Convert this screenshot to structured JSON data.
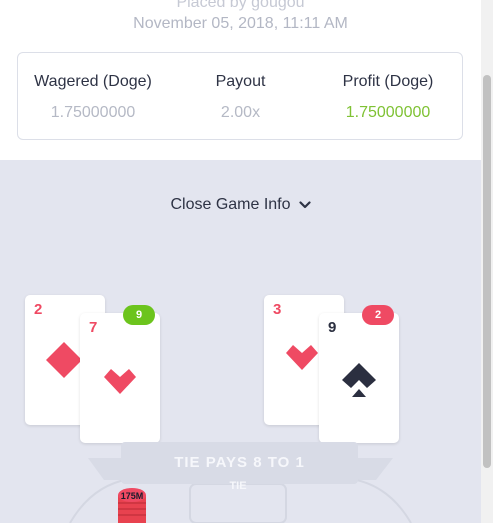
{
  "header": {
    "placed_by": "Placed by gougou",
    "date": "November 05, 2018, 11:11 AM"
  },
  "stats": {
    "wagered": {
      "label": "Wagered (Doge)",
      "value": "1.75000000"
    },
    "payout": {
      "label": "Payout",
      "value": "2.00x"
    },
    "profit": {
      "label": "Profit (Doge)",
      "value": "1.75000000"
    }
  },
  "toggle": {
    "label": "Close Game Info"
  },
  "player_hand": {
    "total": "9",
    "cards": [
      {
        "rank": "2",
        "suit": "diamond-icon"
      },
      {
        "rank": "7",
        "suit": "heart-icon"
      }
    ]
  },
  "banker_hand": {
    "total": "2",
    "cards": [
      {
        "rank": "3",
        "suit": "heart-icon"
      },
      {
        "rank": "9",
        "suit": "spade-icon"
      }
    ]
  },
  "table": {
    "banner": "TIE PAYS 8 TO 1",
    "tie_label": "TIE",
    "chip": "175M"
  },
  "colors": {
    "red": "#ef4a63",
    "green": "#6cc41d",
    "profit": "#7fc234",
    "background": "#e3e5ef"
  }
}
